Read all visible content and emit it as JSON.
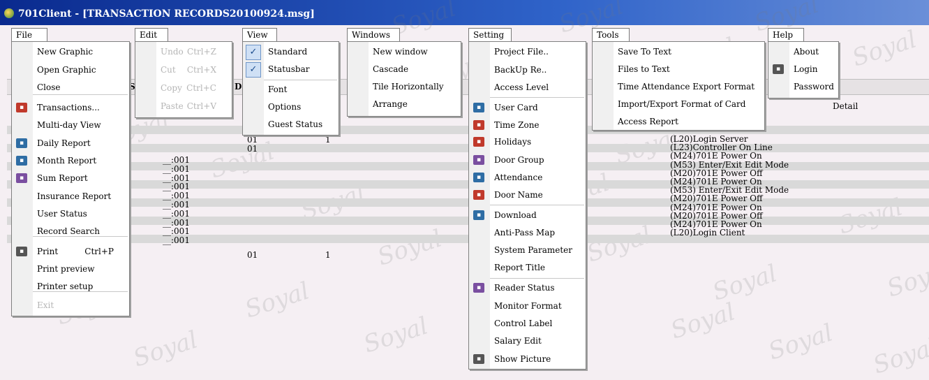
{
  "window": {
    "title": "701Client - [TRANSACTION RECORDS20100924.msg]"
  },
  "menubar": [
    "File",
    "Edit",
    "View",
    "Windows",
    "Setting",
    "Tools",
    "Help"
  ],
  "background": {
    "header_bold_s": "S",
    "header_bold_d": "D",
    "detail_header": "Detail",
    "node_rows": [
      "__:001",
      "__:001",
      "__:001",
      "__:001",
      "__:001",
      "__:001",
      "__:001",
      "__:001",
      "__:001",
      "__:001"
    ],
    "mid_col": [
      "01",
      "01",
      "01"
    ],
    "one_col": [
      "1",
      "1"
    ],
    "details": [
      "(L20)Login   Server",
      "(L23)Controller On Line",
      "(M24)701E Power On",
      "(M53) Enter/Exit Edit Mode",
      "(M20)701E Power Off",
      "(M24)701E Power On",
      "(M53) Enter/Exit Edit Mode",
      "(M20)701E Power Off",
      "(M24)701E Power On",
      "(M20)701E Power Off",
      "(M24)701E Power On",
      "(L20)Login   Client"
    ]
  },
  "menus": {
    "file": {
      "items": [
        {
          "label": "New Graphic",
          "icon": "none",
          "enabled": true
        },
        {
          "label": "Open Graphic",
          "icon": "none",
          "enabled": true
        },
        {
          "label": "Close",
          "icon": "none",
          "enabled": true
        },
        {
          "label": "Transactions...",
          "icon": "transactions-icon",
          "enabled": true
        },
        {
          "label": "Multi-day View",
          "icon": "none",
          "enabled": true
        },
        {
          "label": "Daily Report",
          "icon": "daily-report-icon",
          "enabled": true
        },
        {
          "label": "Month Report",
          "icon": "month-report-icon",
          "enabled": true
        },
        {
          "label": "Sum Report",
          "icon": "sum-report-icon",
          "enabled": true
        },
        {
          "label": "Insurance Report",
          "icon": "none",
          "enabled": true
        },
        {
          "label": "User Status",
          "icon": "none",
          "enabled": true
        },
        {
          "label": "Record Search",
          "icon": "none",
          "enabled": true
        },
        {
          "label": "Print",
          "icon": "print-icon",
          "enabled": true,
          "shortcut": "Ctrl+P"
        },
        {
          "label": "Print preview",
          "icon": "none",
          "enabled": true
        },
        {
          "label": "Printer setup",
          "icon": "none",
          "enabled": true
        },
        {
          "label": "Exit",
          "icon": "none",
          "enabled": false
        }
      ]
    },
    "edit": {
      "items": [
        {
          "label": "Undo",
          "shortcut": "Ctrl+Z"
        },
        {
          "label": "Cut",
          "shortcut": "Ctrl+X"
        },
        {
          "label": "Copy",
          "shortcut": "Ctrl+C"
        },
        {
          "label": "Paste",
          "shortcut": "Ctrl+V"
        }
      ]
    },
    "view": {
      "items": [
        {
          "label": "Standard",
          "checked": true
        },
        {
          "label": "Statusbar",
          "checked": true
        },
        {
          "label": "Font",
          "checked": false
        },
        {
          "label": "Options",
          "checked": false
        },
        {
          "label": "Guest Status",
          "checked": false
        }
      ]
    },
    "windows": {
      "items": [
        "New window",
        "Cascade",
        "Tile Horizontally",
        "Arrange"
      ]
    },
    "setting": {
      "items": [
        "Project File..",
        "BackUp Re..",
        "Access Level",
        "User Card",
        "Time Zone",
        "Holidays",
        "Door Group",
        "Attendance",
        "Door Name",
        "Download",
        "Anti-Pass Map",
        "System Parameter",
        "Report Title",
        "Reader Status",
        "Monitor Format",
        "Control Label",
        "Salary Edit",
        "Show Picture"
      ]
    },
    "tools": {
      "items": [
        "Save To Text",
        "Files to Text",
        "Time Attendance Export Format",
        "Import/Export Format of Card",
        "Access Report"
      ]
    },
    "help": {
      "items": [
        "About",
        "Login",
        "Password"
      ]
    }
  },
  "watermark_text": "Soyal"
}
